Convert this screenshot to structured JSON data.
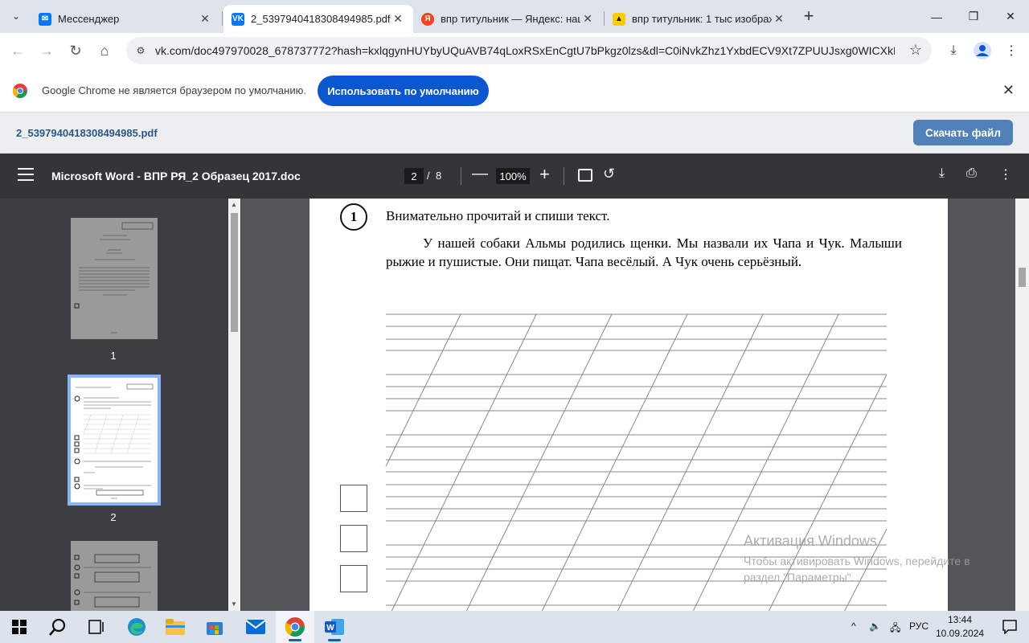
{
  "browser": {
    "tabs": [
      {
        "title": "Мессенджер",
        "favicon": "vk-messenger-icon",
        "active": false
      },
      {
        "title": "2_5397940418308494985.pdf",
        "favicon": "vk-icon",
        "active": true
      },
      {
        "title": "впр титульник — Яндекс: наш",
        "favicon": "yandex-icon",
        "active": false
      },
      {
        "title": "впр титульник: 1 тыс изображ",
        "favicon": "yandex-images-icon",
        "active": false
      }
    ],
    "url": "vk.com/doc497970028_678737772?hash=kxlqgynHUYbyUQuAVB74qLoxRSxEnCgtU7bPkgz0lzs&dl=C0iNvkZhz1YxbdECV9Xt7ZPUUJsxg0WICXkHui2..."
  },
  "infobar": {
    "message": "Google Chrome не является браузером по умолчанию.",
    "button": "Использовать по умолчанию"
  },
  "vk": {
    "filename": "2_5397940418308494985.pdf",
    "download": "Скачать файл"
  },
  "pdf": {
    "title": "Microsoft Word - ВПР РЯ_2 Образец 2017.doc",
    "page": "2",
    "separator": "/",
    "total": "8",
    "zoom": "100%",
    "thumbnails": [
      "1",
      "2"
    ],
    "task": {
      "number": "1",
      "title": "Внимательно прочитай и спиши текст.",
      "text": "У нашей собаки Альмы родились щенки. Мы назвали их Чапа и Чук. Малыши рыжие и пушистые. Они пищат. Чапа весёлый. А Чук очень серьёзный."
    }
  },
  "watermark": {
    "title": "Активация Windows",
    "line1": "Чтобы активировать Windows, перейдите в",
    "line2": "раздел \"Параметры\"."
  },
  "taskbar": {
    "lang": "РУС",
    "time": "13:44",
    "date": "10.09.2024"
  },
  "colors": {
    "accent": "#0b57d0",
    "vk_blue": "#5181b8",
    "pdf_toolbar": "#323639"
  }
}
